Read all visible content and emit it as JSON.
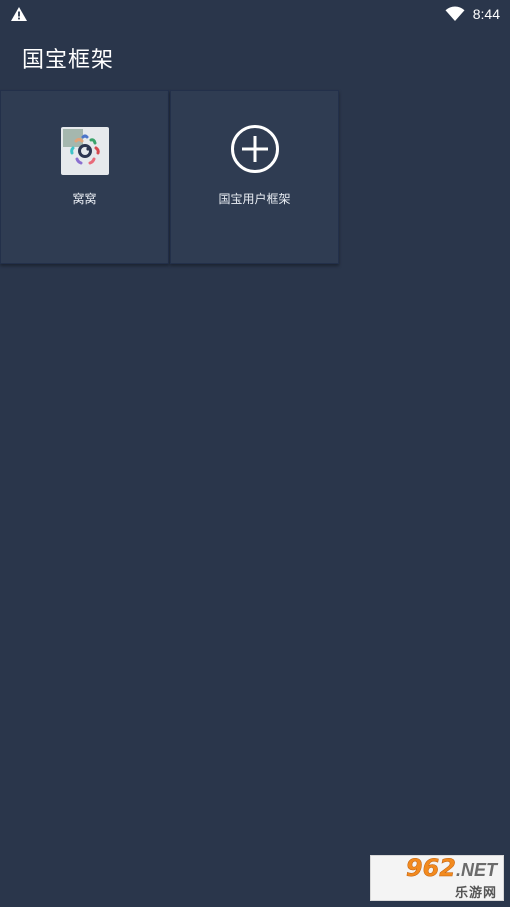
{
  "status_bar": {
    "time": "8:44",
    "left_icon": "warning-icon",
    "right_icon": "wifi-icon"
  },
  "app_bar": {
    "title": "国宝框架"
  },
  "tiles": [
    {
      "label": "窝窝",
      "icon": "app-icon-wowo"
    },
    {
      "label": "国宝用户框架",
      "icon": "add-circle-icon"
    }
  ],
  "watermark": {
    "number": "962",
    "domain": ".NET",
    "subtitle": "乐游网"
  },
  "colors": {
    "background": "#2a364b",
    "tile": "#2f3c52",
    "text": "#ffffff",
    "watermark_accent": "#f28a1e"
  }
}
